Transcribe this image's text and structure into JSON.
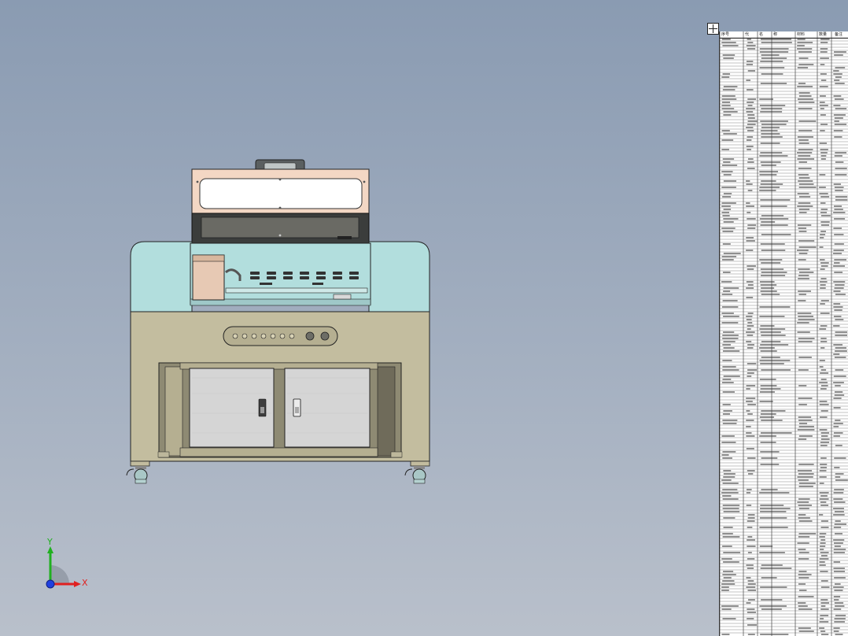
{
  "bom": {
    "columns": [
      "序号",
      "代",
      "名",
      "称",
      "材料",
      "数量",
      "备注"
    ]
  },
  "triad": {
    "x_label": "X",
    "y_label": "Y"
  },
  "colors": {
    "background_top": "#8a9bb2",
    "background_bottom": "#b9c0cb",
    "cabinet_body": "#c3bd9f",
    "upper_housing": "#b2dedd",
    "lid": "#f3d7c4",
    "drawer_panel": "#d5d5d5",
    "table_background": "#ffffff",
    "axis_x": "#e02020",
    "axis_y": "#20b020",
    "axis_z": "#2040e0"
  },
  "icons": {
    "table_anchor": "move-handle-icon",
    "triad": "axis-triad-icon"
  }
}
